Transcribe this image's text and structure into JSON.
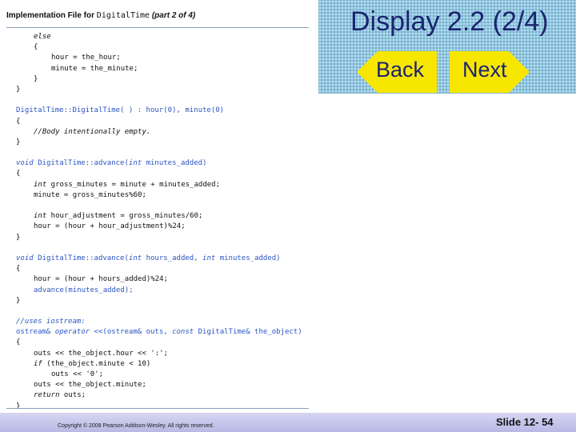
{
  "header": {
    "label": "Implementation File for",
    "class_name": "DigitalTime",
    "part": "(part 2 of 4)"
  },
  "code": {
    "l01": "else",
    "l02": "{",
    "l03": "hour = the_hour;",
    "l04": "minute = the_minute;",
    "l05": "}",
    "l06": "}",
    "l07": "DigitalTime::DigitalTime( ) : hour(0), minute(0)",
    "l08": "{",
    "l09": "//Body intentionally empty.",
    "l10": "}",
    "l11a": "void",
    "l11b": " DigitalTime::advance(",
    "l11c": "int",
    "l11d": " minutes_added)",
    "l12": "{",
    "l13a": "int",
    "l13b": " gross_minutes = minute + minutes_added;",
    "l14": "minute = gross_minutes%60;",
    "l15a": "int",
    "l15b": " hour_adjustment = gross_minutes/60;",
    "l16": "hour = (hour + hour_adjustment)%24;",
    "l17": "}",
    "l18a": "void",
    "l18b": " DigitalTime::advance(",
    "l18c": "int",
    "l18d": " hours_added, ",
    "l18e": "int",
    "l18f": " minutes_added)",
    "l19": "{",
    "l20": "hour = (hour + hours_added)%24;",
    "l21": "advance(minutes_added);",
    "l22": "}",
    "l23": "//uses iostream:",
    "l24a": "ostream& ",
    "l24b": "operator",
    "l24c": " <<(ostream& outs, ",
    "l24d": "const",
    "l24e": " DigitalTime& the_object)",
    "l25": "{",
    "l26": "outs << the_object.hour << ':';",
    "l27a": "if",
    "l27b": " (the_object.minute < 10)",
    "l28": "outs << '0';",
    "l29": "outs << the_object.minute;",
    "l30a": "return",
    "l30b": " outs;",
    "l31": "}"
  },
  "slide": {
    "title": "Display 2.2 (2/4)",
    "back_label": "Back",
    "next_label": "Next",
    "copyright": "Copyright © 2008 Pearson Addison-Wesley. All rights reserved.",
    "slide_number": "Slide 12- 54"
  },
  "colors": {
    "panel": "#8ec6e0",
    "nav_button": "#f7e600",
    "title_text": "#1a2470",
    "code_blue": "#2a55c4",
    "footer": "#c8c8ec"
  }
}
